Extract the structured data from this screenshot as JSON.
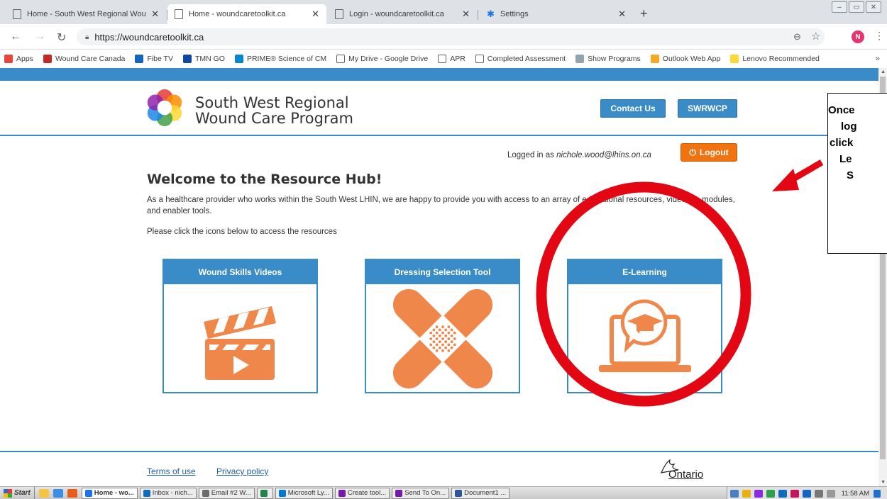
{
  "browser": {
    "tabs": [
      {
        "title": "Home - South West Regional Wound",
        "active": false,
        "icon": "page-icon"
      },
      {
        "title": "Home - woundcaretoolkit.ca",
        "active": true,
        "icon": "page-icon"
      },
      {
        "title": "Login - woundcaretoolkit.ca",
        "active": false,
        "icon": "page-icon"
      },
      {
        "title": "Settings",
        "active": false,
        "icon": "gear-icon"
      }
    ],
    "url": "https://woundcaretoolkit.ca",
    "profile_initial": "N",
    "bookmarks": [
      {
        "label": "Apps",
        "color": "#e8453c"
      },
      {
        "label": "Wound Care Canada",
        "color": "#c62828"
      },
      {
        "label": "Fibe TV",
        "color": "#1565c0"
      },
      {
        "label": "TMN GO",
        "color": "#0d47a1"
      },
      {
        "label": "PRIME® Science of CM",
        "color": "#0288d1"
      },
      {
        "label": "My Drive - Google Drive",
        "color": "#ffffff"
      },
      {
        "label": "APR",
        "color": "#ffffff"
      },
      {
        "label": "Completed Assessment",
        "color": "#ffffff"
      },
      {
        "label": "Show Programs",
        "color": "#90a4ae"
      },
      {
        "label": "Outlook Web App",
        "color": "#f9a825"
      },
      {
        "label": "Lenovo Recommended",
        "color": "#fdd835"
      }
    ],
    "bookmarks_more": "»"
  },
  "site": {
    "org_name_line1": "South West Regional",
    "org_name_line2": "Wound Care Program",
    "contact_label": "Contact Us",
    "swrwcp_label": "SWRWCP",
    "logged_in_prefix": "Logged in as",
    "user_email": "nichole.wood@lhins.on.ca",
    "logout_label": "Logout",
    "welcome_title": "Welcome to the Resource Hub!",
    "intro_text": "As a healthcare provider who works within the South West LHIN, we are happy to provide you with access to an array of educational resources, videos, e-modules, and enabler tools.",
    "instruction_text": "Please click the icons below to access the resources",
    "cards": [
      {
        "title": "Wound Skills Videos",
        "icon": "clapperboard-icon"
      },
      {
        "title": "Dressing Selection Tool",
        "icon": "bandage-icon"
      },
      {
        "title": "E-Learning",
        "icon": "laptop-graduation-icon"
      }
    ],
    "footer_terms": "Terms of use",
    "footer_privacy": "Privacy policy",
    "ontario_label": "Ontario",
    "accent": "#3a8cc8",
    "icon_orange": "#f0874a",
    "logout_color": "#f0730f"
  },
  "annotation": {
    "callout_lines": [
      "Once",
      "log",
      "click",
      "Le",
      "S"
    ],
    "ring_color": "#e30613",
    "arrow_color": "#e30613"
  },
  "taskbar": {
    "start_label": "Start",
    "buttons": [
      {
        "label": "Home - wo...",
        "active": true,
        "color": "#1a73e8"
      },
      {
        "label": "Inbox - nich...",
        "active": false,
        "color": "#0f6cbd"
      },
      {
        "label": "Email #2 W...",
        "active": false,
        "color": "#6b6b6b"
      },
      {
        "label": "",
        "active": false,
        "color": "#1e8449"
      },
      {
        "label": "Microsoft Ly...",
        "active": false,
        "color": "#0078d4"
      },
      {
        "label": "Create tool...",
        "active": false,
        "color": "#7719aa"
      },
      {
        "label": "Send To On...",
        "active": false,
        "color": "#7719aa"
      },
      {
        "label": "Document1 ...",
        "active": false,
        "color": "#2b579a"
      }
    ],
    "clock": "11:58 AM"
  }
}
